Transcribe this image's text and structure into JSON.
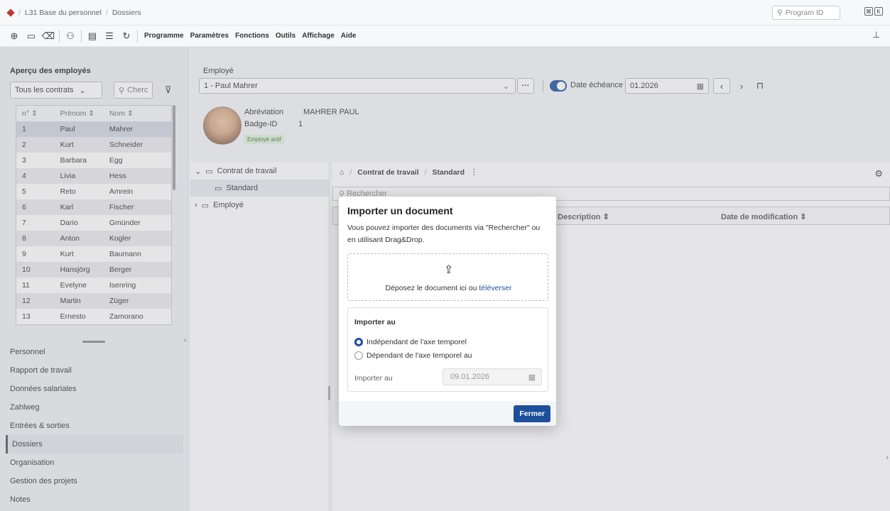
{
  "title_bar": {
    "breadcrumb": [
      "L31 Base du personnel",
      "Dossiers"
    ],
    "program_search_placeholder": "Program ID"
  },
  "toolbar": {
    "menu": [
      "Programme",
      "Paramètres",
      "Fonctions",
      "Outils",
      "Affichage",
      "Aide"
    ]
  },
  "left_panel": {
    "title": "Aperçu des employés",
    "contract_select": "Tous les contrats",
    "search_placeholder": "Cherc",
    "columns": [
      "n°",
      "Prénom",
      "Nom"
    ],
    "rows": [
      [
        "1",
        "Paul",
        "Mahrer"
      ],
      [
        "2",
        "Kurt",
        "Schneider"
      ],
      [
        "3",
        "Barbara",
        "Egg"
      ],
      [
        "4",
        "Livia",
        "Hess"
      ],
      [
        "5",
        "Reto",
        "Amrein"
      ],
      [
        "6",
        "Karl",
        "Fischer"
      ],
      [
        "7",
        "Dario",
        "Gmünder"
      ],
      [
        "8",
        "Anton",
        "Kogler"
      ],
      [
        "9",
        "Kurt",
        "Baumann"
      ],
      [
        "10",
        "Hansjörg",
        "Berger"
      ],
      [
        "11",
        "Evelyne",
        "Isenring"
      ],
      [
        "12",
        "Martin",
        "Züger"
      ],
      [
        "13",
        "Ernesto",
        "Zamorano"
      ]
    ],
    "nav": [
      "Personnel",
      "Rapport de travail",
      "Données salariales",
      "Zahlweg",
      "Entrées & sorties",
      "Dossiers",
      "Organisation",
      "Gestion des projets",
      "Notes"
    ],
    "active_nav": "Dossiers"
  },
  "employee": {
    "label": "Employé",
    "selected": "1 - Paul Mahrer",
    "date_label": "Date échéance",
    "date_value": "01.2026",
    "abbreviation_label": "Abréviation",
    "abbreviation_value": "MAHRER PAUL",
    "badge_label": "Badge-ID",
    "badge_value": "1",
    "status": "Employé actif"
  },
  "tree": {
    "nodes": [
      "Contrat de travail",
      "Standard",
      "Employé"
    ]
  },
  "documents": {
    "breadcrumb": [
      "Contrat de travail",
      "Standard"
    ],
    "search_placeholder": "Rechercher",
    "columns": [
      "Description",
      "Date de modification"
    ]
  },
  "modal": {
    "title": "Importer un document",
    "text": "Vous pouvez importer des documents via \"Rechercher\" ou en utilisant Drag&Drop.",
    "drop_text": "Déposez le document ici ou ",
    "drop_link": "téléverser",
    "import_title": "Importer au",
    "option1": "Indépendant de l'axe temporel",
    "option2": "Dépendant de l'axe temporel au",
    "import_label": "Importer au",
    "import_date": "09.01.2026",
    "close_label": "Fermer"
  },
  "colors": {
    "accent": "#1e4f9c",
    "status_green": "#dff0d8"
  }
}
